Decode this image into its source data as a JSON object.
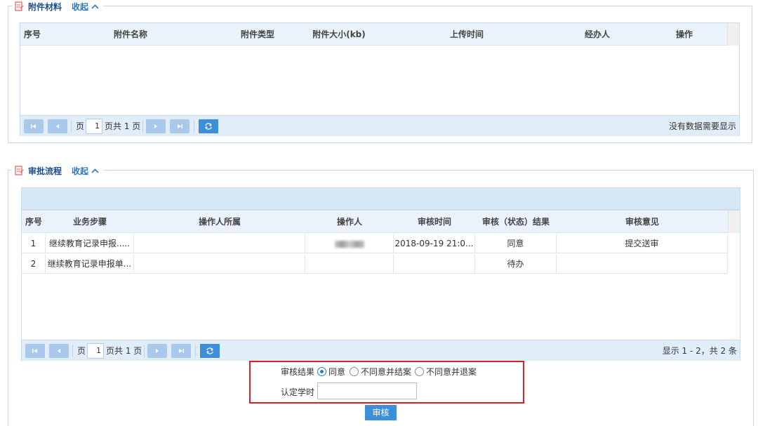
{
  "attachments": {
    "title": "附件材料",
    "collapse_label": "收起",
    "columns": [
      "序号",
      "附件名称",
      "附件类型",
      "附件大小(kb)",
      "上传时间",
      "经办人",
      "操作"
    ],
    "pager": {
      "page_label": "页",
      "page_value": "1",
      "total_label": "页共 1 页",
      "info": "没有数据需要显示"
    }
  },
  "approval": {
    "title": "审批流程",
    "collapse_label": "收起",
    "columns": [
      "序号",
      "业务步骤",
      "操作人所属",
      "操作人",
      "审核时间",
      "审核（状态）结果",
      "审核意见"
    ],
    "rows": [
      {
        "seq": "1",
        "step": "继续教育记录申报.....",
        "org": "",
        "operator": "",
        "time": "2018-09-19 21:0...",
        "result": "同意",
        "opinion": "提交送审"
      },
      {
        "seq": "2",
        "step": "继续教育记录申报单...",
        "org": "",
        "operator": "",
        "time": "",
        "result": "待办",
        "opinion": ""
      }
    ],
    "pager": {
      "page_label": "页",
      "page_value": "1",
      "total_label": "页共 1 页",
      "info": "显示 1 - 2，共 2 条"
    }
  },
  "review_form": {
    "result_label": "审核结果",
    "options": [
      "同意",
      "不同意并结案",
      "不同意并退案"
    ],
    "selected": "同意",
    "hours_label": "认定学时",
    "hours_value": "",
    "submit_label": "审核"
  },
  "colors": {
    "accent": "#2b79c8",
    "header_bg": "#eaf3fb",
    "pager_bg": "#e1edf9",
    "highlight_border": "#e02020"
  }
}
